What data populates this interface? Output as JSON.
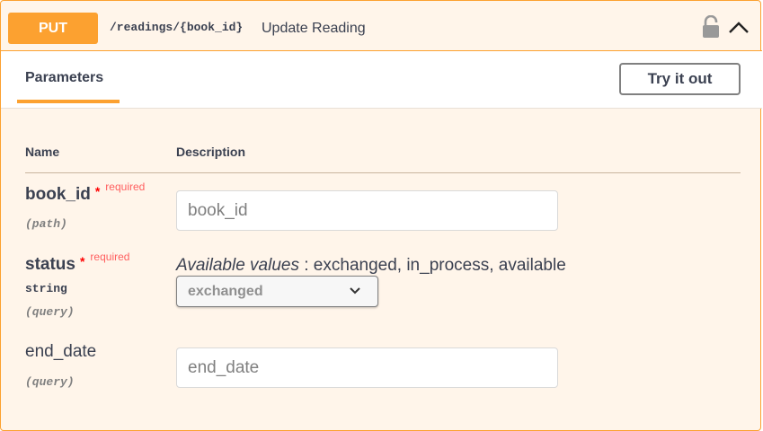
{
  "summary": {
    "method": "PUT",
    "path": "/readings/{book_id}",
    "description": "Update Reading",
    "lock_icon": "unlocked-padlock-icon",
    "collapse_icon": "chevron-up-icon"
  },
  "tabs": {
    "parameters_label": "Parameters",
    "try_it_out_label": "Try it out"
  },
  "table": {
    "col_name": "Name",
    "col_description": "Description"
  },
  "params": [
    {
      "name": "book_id",
      "required_mark": "*",
      "required_text": "required",
      "in": "(path)",
      "placeholder": "book_id"
    },
    {
      "name": "status",
      "required_mark": "*",
      "required_text": "required",
      "type": "string",
      "in": "(query)",
      "available_label": "Available values",
      "available_values": ": exchanged, in_process, available",
      "selected": "exchanged"
    },
    {
      "name": "end_date",
      "in": "(query)",
      "placeholder": "end_date"
    }
  ],
  "colors": {
    "accent": "#fca130",
    "background": "#fff5ea",
    "required": "#ff0000"
  }
}
